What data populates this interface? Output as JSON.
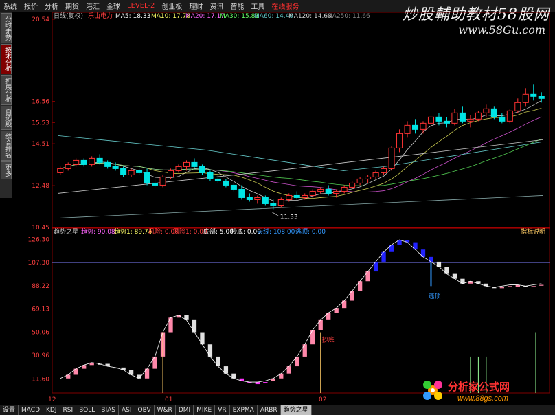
{
  "menu": [
    "系统",
    "报价",
    "分析",
    "期货",
    "港汇",
    "金球",
    "LEVEL-2",
    "创业板",
    "理财",
    "资讯",
    "智能",
    "工具",
    "在线服务"
  ],
  "menu_red": [
    "LEVEL-2",
    "在线服务"
  ],
  "watermark": {
    "text": "炒股輔助教材58股网",
    "url": "www.58Gu.com"
  },
  "sidebar": [
    "分时走势",
    "技术分析",
    "扩展分析",
    "自选股",
    "综合排名",
    "更多"
  ],
  "sidebar_active": 1,
  "main": {
    "header": {
      "period": "日线(复权)",
      "name": "乐山电力",
      "ma5": "MA5: 18.33",
      "ma10": "MA10: 17.78",
      "ma20": "MA20: 17.17",
      "ma30": "MA30: 15.81",
      "ma60": "MA60: 14.40",
      "ma120": "MA120: 14.68",
      "ma250": "MA250: 11.66"
    },
    "y_ticks": [
      "20.54",
      "16.56",
      "15.53",
      "14.51",
      "12.48",
      "10.45"
    ],
    "low_label": "11.33"
  },
  "indicator": {
    "header": {
      "name": "趋势之星",
      "t1": "趋势: 90.08",
      "t2": "趋势1: 89.74",
      "t3": "风险: 0.00",
      "t4": "风险1: 0.00",
      "t5": "底部: 5.00",
      "t6": "抄底: 0.00",
      "t7": "天线: 108.00",
      "t8": "逃顶: 0.00"
    },
    "help": "指标说明",
    "y_ticks": [
      "126.30",
      "107.30",
      "88.22",
      "69.13",
      "50.06",
      "30.96",
      "11.60"
    ],
    "tag_low": "抄底",
    "tag_top": "逃顶"
  },
  "x_labels": [
    "12",
    "01",
    "02"
  ],
  "bottom_tabs": [
    "设置",
    "MACD",
    "KDJ",
    "RSI",
    "BOLL",
    "BIAS",
    "ASI",
    "OBV",
    "W&R",
    "DMI",
    "MIKE",
    "VR",
    "EXPMA",
    "ARBR",
    "趋势之星"
  ],
  "bottom_active": 14,
  "logo": {
    "text": "分析家公式网",
    "url": "www.88gs.com"
  },
  "chart_data": {
    "type": "candlestick",
    "candles": [
      [
        13.1,
        13.4,
        13.0,
        13.3
      ],
      [
        13.3,
        13.6,
        13.2,
        13.5
      ],
      [
        13.5,
        13.8,
        13.4,
        13.7
      ],
      [
        13.7,
        13.8,
        13.4,
        13.5
      ],
      [
        13.5,
        13.9,
        13.4,
        13.8
      ],
      [
        13.8,
        14.0,
        13.5,
        13.6
      ],
      [
        13.6,
        13.7,
        13.3,
        13.4
      ],
      [
        13.4,
        13.6,
        13.2,
        13.3
      ],
      [
        13.3,
        13.4,
        12.9,
        13.0
      ],
      [
        13.0,
        13.3,
        12.9,
        13.2
      ],
      [
        13.2,
        13.4,
        13.0,
        13.1
      ],
      [
        13.1,
        13.3,
        12.5,
        12.6
      ],
      [
        12.6,
        12.8,
        12.4,
        12.5
      ],
      [
        12.5,
        13.0,
        12.4,
        12.9
      ],
      [
        12.9,
        13.3,
        12.8,
        13.2
      ],
      [
        13.2,
        13.5,
        13.1,
        13.4
      ],
      [
        13.4,
        13.7,
        13.2,
        13.6
      ],
      [
        13.6,
        13.8,
        13.3,
        13.4
      ],
      [
        13.4,
        13.5,
        13.0,
        13.1
      ],
      [
        13.1,
        13.2,
        12.7,
        12.8
      ],
      [
        12.8,
        13.0,
        12.6,
        12.7
      ],
      [
        12.7,
        12.8,
        12.4,
        12.5
      ],
      [
        12.5,
        12.6,
        12.2,
        12.3
      ],
      [
        12.3,
        12.5,
        11.8,
        11.9
      ],
      [
        11.9,
        12.1,
        11.7,
        11.8
      ],
      [
        11.8,
        12.0,
        11.6,
        11.9
      ],
      [
        11.9,
        12.0,
        11.5,
        11.6
      ],
      [
        11.6,
        11.8,
        11.33,
        11.5
      ],
      [
        11.5,
        11.9,
        11.4,
        11.8
      ],
      [
        11.8,
        12.1,
        11.7,
        12.0
      ],
      [
        12.0,
        12.2,
        11.8,
        11.9
      ],
      [
        11.9,
        12.1,
        11.8,
        12.0
      ],
      [
        12.0,
        12.3,
        11.9,
        12.2
      ],
      [
        12.2,
        12.4,
        12.1,
        12.3
      ],
      [
        12.3,
        12.5,
        12.0,
        12.1
      ],
      [
        12.1,
        12.3,
        11.9,
        12.2
      ],
      [
        12.2,
        12.5,
        12.1,
        12.4
      ],
      [
        12.4,
        12.7,
        12.3,
        12.6
      ],
      [
        12.6,
        12.9,
        12.5,
        12.8
      ],
      [
        12.8,
        13.0,
        12.6,
        12.9
      ],
      [
        12.9,
        13.2,
        12.8,
        13.1
      ],
      [
        13.1,
        13.4,
        13.0,
        13.3
      ],
      [
        13.3,
        14.4,
        13.2,
        14.3
      ],
      [
        14.3,
        15.2,
        14.1,
        15.0
      ],
      [
        15.0,
        15.6,
        14.8,
        15.4
      ],
      [
        15.4,
        15.7,
        15.0,
        15.2
      ],
      [
        15.2,
        15.6,
        15.0,
        15.5
      ],
      [
        15.5,
        15.9,
        15.3,
        15.8
      ],
      [
        15.8,
        16.0,
        15.4,
        15.6
      ],
      [
        15.6,
        15.8,
        15.3,
        15.5
      ],
      [
        15.5,
        16.2,
        15.4,
        16.0
      ],
      [
        16.0,
        16.3,
        15.5,
        15.6
      ],
      [
        15.6,
        15.9,
        15.3,
        15.7
      ],
      [
        15.7,
        16.1,
        15.6,
        16.0
      ],
      [
        16.0,
        16.4,
        15.8,
        16.2
      ],
      [
        16.2,
        16.3,
        15.7,
        15.8
      ],
      [
        15.8,
        16.0,
        15.5,
        15.6
      ],
      [
        15.6,
        16.2,
        15.5,
        16.1
      ],
      [
        16.1,
        16.7,
        16.0,
        16.5
      ],
      [
        16.5,
        17.2,
        16.3,
        16.9
      ],
      [
        16.9,
        17.4,
        16.6,
        16.8
      ],
      [
        16.8,
        17.0,
        16.5,
        16.7
      ]
    ],
    "indicator_values": [
      12,
      15,
      20,
      23,
      25,
      24,
      22,
      21,
      19,
      15,
      12,
      20,
      30,
      50,
      62,
      64,
      60,
      50,
      40,
      30,
      22,
      16,
      12,
      10,
      9,
      9,
      10,
      12,
      16,
      22,
      30,
      40,
      52,
      60,
      66,
      70,
      76,
      84,
      92,
      100,
      108,
      116,
      122,
      126,
      124,
      118,
      112,
      108,
      104,
      98,
      94,
      90,
      92,
      90,
      88,
      87,
      88,
      89,
      89,
      88,
      89,
      90
    ],
    "y_range_main": [
      10.45,
      20.54
    ],
    "y_range_ind": [
      0,
      130
    ]
  }
}
